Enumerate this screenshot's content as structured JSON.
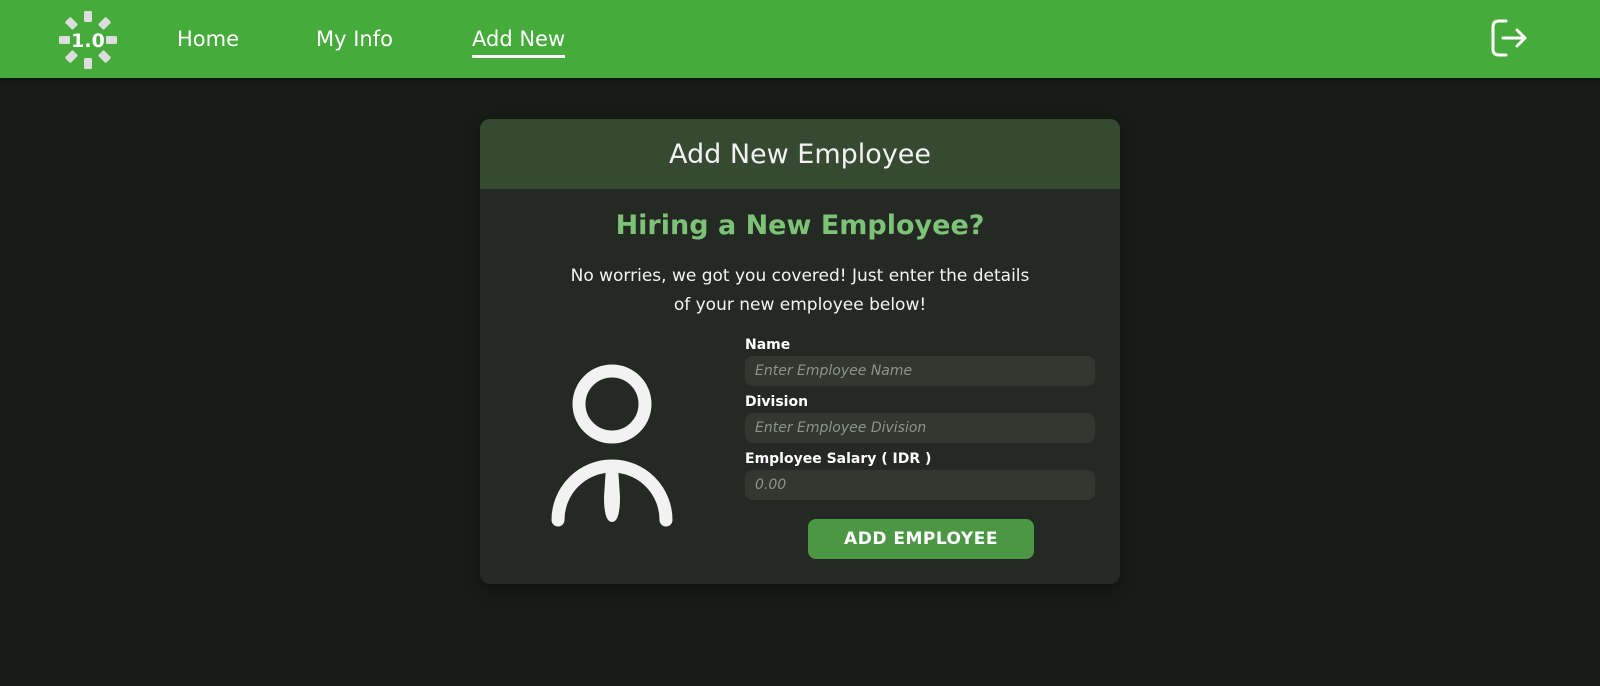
{
  "colors": {
    "navbar": "#45ac3c",
    "background": "#181c17",
    "card": "#252923",
    "card_header": "#364a32",
    "accent_text": "#7dc377",
    "input": "#323830",
    "button": "#4b9744"
  },
  "navbar": {
    "logo_text": "1.0",
    "links": [
      {
        "label": "Home",
        "active": false
      },
      {
        "label": "My Info",
        "active": false
      },
      {
        "label": "Add New",
        "active": true
      }
    ],
    "logout_icon": "logout-icon"
  },
  "card": {
    "title": "Add New Employee",
    "subtitle": "Hiring a New Employee?",
    "intro": "No worries, we got you covered! Just enter the details of your new employee below!",
    "avatar_icon": "employee-avatar-icon",
    "form": {
      "name": {
        "label": "Name",
        "placeholder": "Enter Employee Name",
        "value": ""
      },
      "division": {
        "label": "Division",
        "placeholder": "Enter Employee Division",
        "value": ""
      },
      "salary": {
        "label": "Employee Salary ( IDR )",
        "placeholder": "0.00",
        "value": ""
      },
      "submit_label": "ADD EMPLOYEE"
    }
  }
}
